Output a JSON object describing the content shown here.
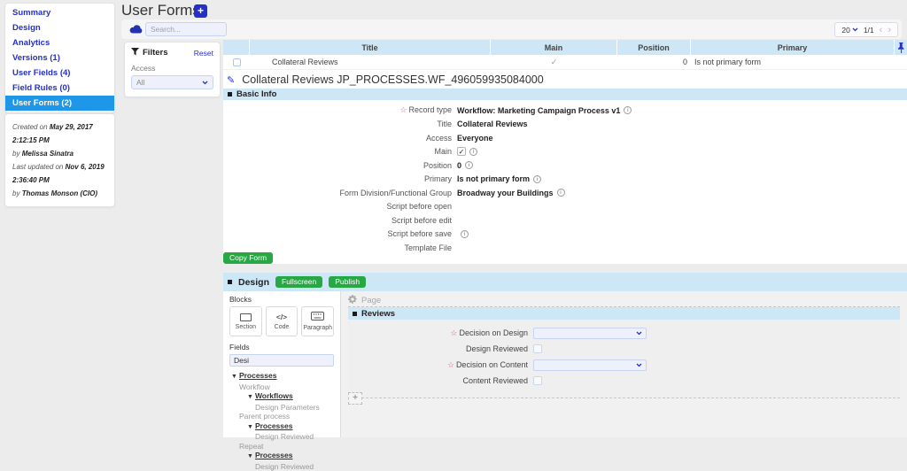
{
  "colors": {
    "accent_blue": "#2430c8",
    "active_item_blue": "#1f97e8",
    "section_header_blue": "#cde7f6",
    "action_green": "#28a745",
    "required_star_pink": "#e75a8c",
    "input_bg": "#eef1fb"
  },
  "sidebar": {
    "items": [
      {
        "label": "Summary"
      },
      {
        "label": "Design"
      },
      {
        "label": "Analytics"
      },
      {
        "label": "Versions (1)"
      },
      {
        "label": "User Fields (4)"
      },
      {
        "label": "Field Rules (0)"
      },
      {
        "label": "User Forms (2)"
      }
    ],
    "meta": {
      "created_label": "Created on",
      "created_value": "May 29, 2017 2:12:15 PM",
      "created_by_label": "by",
      "created_by_value": "Melissa Sinatra",
      "updated_label": "Last updated on",
      "updated_value": "Nov 6, 2019 2:36:40 PM",
      "updated_by_label": "by",
      "updated_by_value": "Thomas Monson (CIO)"
    }
  },
  "header": {
    "title": "User Forms",
    "add_button": "+"
  },
  "toolbar": {
    "search_placeholder": "Search...",
    "page_size": "20",
    "page_position": "1/1",
    "prev": "‹",
    "next": "›"
  },
  "filters": {
    "title": "Filters",
    "reset": "Reset",
    "access_label": "Access",
    "access_value": "All"
  },
  "table": {
    "columns": [
      "Title",
      "Main",
      "Position",
      "Primary"
    ],
    "row": {
      "title": "Collateral Reviews",
      "main": "✓",
      "position": "0",
      "primary": "Is not primary form"
    }
  },
  "detail": {
    "title": "Collateral Reviews JP_PROCESSES.WF_496059935084000",
    "basic_info": {
      "header": "Basic Info",
      "fields": [
        {
          "label": "Record type",
          "value": "Workflow: Marketing Campaign Process v1",
          "required": true,
          "info": true
        },
        {
          "label": "Title",
          "value": "Collateral Reviews"
        },
        {
          "label": "Access",
          "value": "Everyone"
        },
        {
          "label": "Main",
          "checked": true,
          "check_glyph": "✓",
          "info": true
        },
        {
          "label": "Position",
          "value": "0",
          "info": true
        },
        {
          "label": "Primary",
          "value": "Is not primary form",
          "info": true
        },
        {
          "label": "Form Division/Functional Group",
          "value": "Broadway your Buildings",
          "info": true
        },
        {
          "label": "Script before open",
          "value": ""
        },
        {
          "label": "Script before edit",
          "value": ""
        },
        {
          "label": "Script before save",
          "value": "",
          "info": true
        },
        {
          "label": "Template File",
          "value": ""
        }
      ],
      "copy_button": "Copy Form"
    },
    "design": {
      "header": "Design",
      "fullscreen_button": "Fullscreen",
      "publish_button": "Publish",
      "blocks_label": "Blocks",
      "blocks": [
        {
          "label": "Section"
        },
        {
          "label": "Code",
          "glyph": "</>"
        },
        {
          "label": "Paragraph"
        }
      ],
      "fields_label": "Fields",
      "fields_filter_value": "Desi",
      "tree": [
        {
          "label": "Processes",
          "kind": "group",
          "indent": 0
        },
        {
          "label": "Workflow",
          "kind": "leaf",
          "indent": 1
        },
        {
          "label": "Workflows",
          "kind": "group",
          "indent": 2
        },
        {
          "label": "Design Parameters",
          "kind": "leaf",
          "indent": 3
        },
        {
          "label": "Parent process",
          "kind": "leaf",
          "indent": 1
        },
        {
          "label": "Processes",
          "kind": "group",
          "indent": 2
        },
        {
          "label": "Design Reviewed",
          "kind": "leaf",
          "indent": 3
        },
        {
          "label": "Repeat",
          "kind": "leaf",
          "indent": 1
        },
        {
          "label": "Processes",
          "kind": "group",
          "indent": 2
        },
        {
          "label": "Design Reviewed",
          "kind": "leaf",
          "indent": 3
        }
      ],
      "canvas": {
        "page_label": "Page",
        "section_header": "Reviews",
        "form_fields": [
          {
            "label": "Decision on Design",
            "type": "select",
            "required": true,
            "value": ""
          },
          {
            "label": "Design Reviewed",
            "type": "checkbox",
            "checked": false
          },
          {
            "label": "Decision on Content",
            "type": "select",
            "required": true,
            "value": ""
          },
          {
            "label": "Content Reviewed",
            "type": "checkbox",
            "checked": false
          }
        ]
      }
    }
  }
}
